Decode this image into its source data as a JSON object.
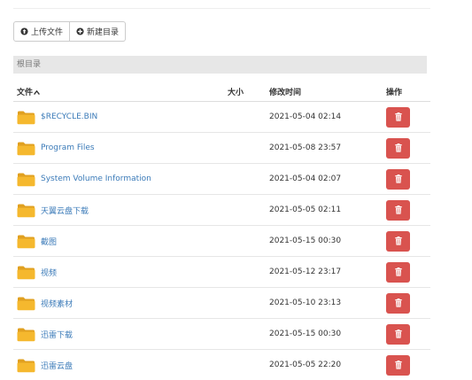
{
  "toolbar": {
    "upload_label": "上传文件",
    "upload_icon": "upload-circle-icon",
    "newdir_label": "新建目录",
    "newdir_icon": "plus-circle-icon"
  },
  "breadcrumb": {
    "root": "根目录"
  },
  "table": {
    "headers": {
      "name": "文件",
      "size": "大小",
      "modified": "修改时间",
      "actions": "操作"
    },
    "sort_icon": "caret-up-icon",
    "rows": [
      {
        "name": "$RECYCLE.BIN",
        "size": "",
        "modified": "2021-05-04 02:14"
      },
      {
        "name": "Program Files",
        "size": "",
        "modified": "2021-05-08 23:57"
      },
      {
        "name": "System Volume Information",
        "size": "",
        "modified": "2021-05-04 02:07"
      },
      {
        "name": "天翼云盘下载",
        "size": "",
        "modified": "2021-05-05 02:11"
      },
      {
        "name": "截图",
        "size": "",
        "modified": "2021-05-15 00:30"
      },
      {
        "name": "视频",
        "size": "",
        "modified": "2021-05-12 23:17"
      },
      {
        "name": "视频素材",
        "size": "",
        "modified": "2021-05-10 23:13"
      },
      {
        "name": "迅雷下载",
        "size": "",
        "modified": "2021-05-15 00:30"
      },
      {
        "name": "迅雷云盘",
        "size": "",
        "modified": "2021-05-05 22:20"
      }
    ]
  },
  "colors": {
    "folder": "#f5b82e",
    "delete": "#d9534f",
    "link": "#3a7ab8",
    "breadcrumb_bg": "#e7e7e7"
  }
}
